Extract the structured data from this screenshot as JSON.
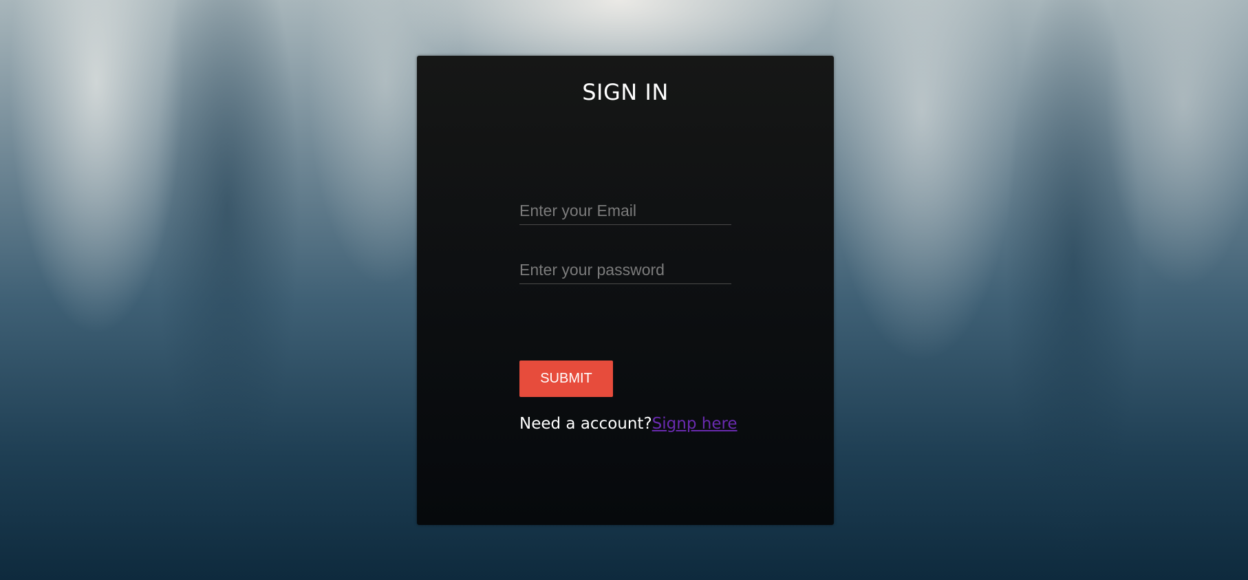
{
  "login": {
    "title": "SIGN IN",
    "email_placeholder": "Enter your Email",
    "password_placeholder": "Enter your password",
    "submit_label": "SUBMIT",
    "signup_prompt": "Need a account?",
    "signup_link": "Signp here"
  },
  "colors": {
    "card_background": "#0e1012",
    "submit_button": "#e74c3c",
    "link": "#6a2bb0",
    "placeholder_text": "#7b7b7b"
  }
}
